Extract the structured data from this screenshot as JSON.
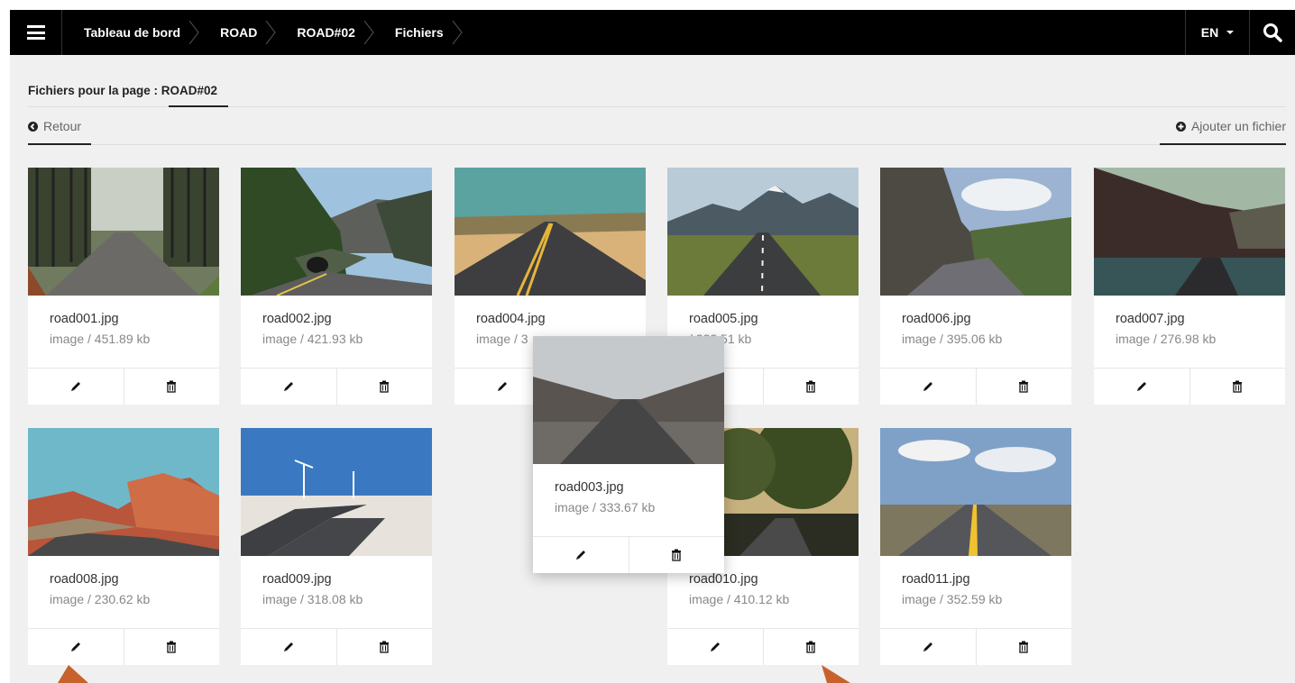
{
  "topbar": {
    "breadcrumbs": [
      "Tableau de bord",
      "ROAD",
      "ROAD#02",
      "Fichiers"
    ],
    "language": "EN"
  },
  "page": {
    "title": "Fichiers pour la page : ROAD#02",
    "back_label": "Retour",
    "add_label": "Ajouter un fichier"
  },
  "files": [
    {
      "name": "road001.jpg",
      "meta": "image / 451.89 kb"
    },
    {
      "name": "road002.jpg",
      "meta": "image / 421.93 kb"
    },
    {
      "name": "road004.jpg",
      "meta": "image / 3"
    },
    {
      "name": "road005.jpg",
      "meta": "/ 222.51 kb"
    },
    {
      "name": "road006.jpg",
      "meta": "image / 395.06 kb"
    },
    {
      "name": "road007.jpg",
      "meta": "image / 276.98 kb"
    },
    {
      "name": "road008.jpg",
      "meta": "image / 230.62 kb"
    },
    {
      "name": "road009.jpg",
      "meta": "image / 318.08 kb"
    },
    {
      "name": "road010.jpg",
      "meta": "image / 410.12 kb"
    },
    {
      "name": "road011.jpg",
      "meta": "image / 352.59 kb"
    }
  ],
  "dragging": {
    "name": "road003.jpg",
    "meta": "image / 333.67 kb"
  },
  "colors": {
    "topbar": "#000000",
    "background": "#f0f0f0",
    "card": "#ffffff",
    "annotation_arrow": "#c8612b"
  },
  "icons": {
    "menu": "hamburger-icon",
    "search": "search-icon",
    "back": "arrow-left-circle-icon",
    "add": "plus-circle-icon",
    "edit": "pencil-icon",
    "delete": "trash-icon"
  }
}
